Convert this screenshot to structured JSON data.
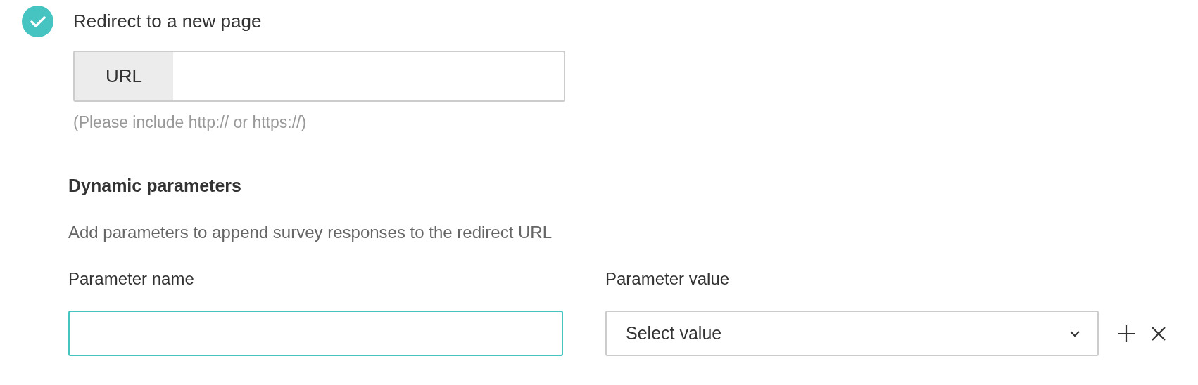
{
  "redirect_option": {
    "label": "Redirect to a new page",
    "checked": true
  },
  "url_field": {
    "addon": "URL",
    "hint": "(Please include http:// or https://)"
  },
  "dynamic_parameters": {
    "title": "Dynamic parameters",
    "description": "Add parameters to append survey responses to the redirect URL",
    "name_label": "Parameter name",
    "value_label": "Parameter value",
    "rows": [
      {
        "name_focused": true,
        "value_placeholder": "Select value"
      }
    ]
  }
}
